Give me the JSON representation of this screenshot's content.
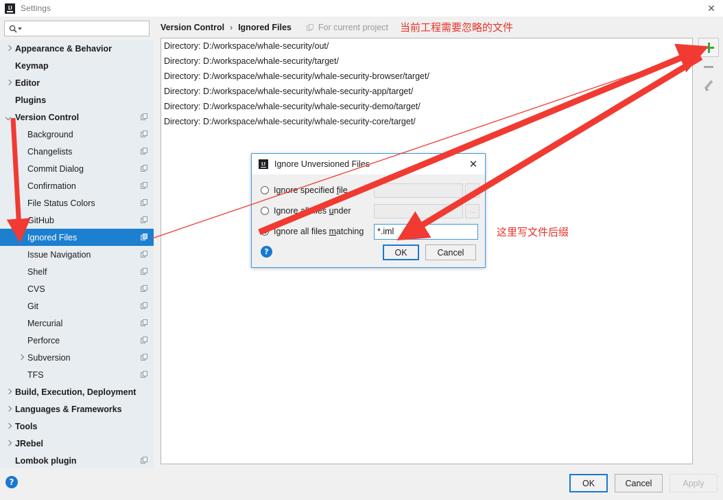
{
  "window": {
    "title": "Settings",
    "logo_text": "IJ",
    "close_label": "✕"
  },
  "search": {
    "placeholder": "",
    "value": "",
    "icon": "search-icon"
  },
  "sidebar": {
    "items": [
      {
        "label": "Appearance & Behavior",
        "level": 0,
        "bold": true,
        "twisty": "right",
        "copy": false,
        "selected": false
      },
      {
        "label": "Keymap",
        "level": 0,
        "bold": true,
        "twisty": "none",
        "copy": false,
        "selected": false
      },
      {
        "label": "Editor",
        "level": 0,
        "bold": true,
        "twisty": "right",
        "copy": false,
        "selected": false
      },
      {
        "label": "Plugins",
        "level": 0,
        "bold": true,
        "twisty": "none",
        "copy": false,
        "selected": false
      },
      {
        "label": "Version Control",
        "level": 0,
        "bold": true,
        "twisty": "down",
        "copy": true,
        "selected": false
      },
      {
        "label": "Background",
        "level": 1,
        "bold": false,
        "twisty": "none",
        "copy": true,
        "selected": false
      },
      {
        "label": "Changelists",
        "level": 1,
        "bold": false,
        "twisty": "none",
        "copy": true,
        "selected": false
      },
      {
        "label": "Commit Dialog",
        "level": 1,
        "bold": false,
        "twisty": "none",
        "copy": true,
        "selected": false
      },
      {
        "label": "Confirmation",
        "level": 1,
        "bold": false,
        "twisty": "none",
        "copy": true,
        "selected": false
      },
      {
        "label": "File Status Colors",
        "level": 1,
        "bold": false,
        "twisty": "none",
        "copy": true,
        "selected": false
      },
      {
        "label": "GitHub",
        "level": 1,
        "bold": false,
        "twisty": "none",
        "copy": true,
        "selected": false
      },
      {
        "label": "Ignored Files",
        "level": 1,
        "bold": false,
        "twisty": "none",
        "copy": true,
        "selected": true
      },
      {
        "label": "Issue Navigation",
        "level": 1,
        "bold": false,
        "twisty": "none",
        "copy": true,
        "selected": false
      },
      {
        "label": "Shelf",
        "level": 1,
        "bold": false,
        "twisty": "none",
        "copy": true,
        "selected": false
      },
      {
        "label": "CVS",
        "level": 1,
        "bold": false,
        "twisty": "none",
        "copy": true,
        "selected": false
      },
      {
        "label": "Git",
        "level": 1,
        "bold": false,
        "twisty": "none",
        "copy": true,
        "selected": false
      },
      {
        "label": "Mercurial",
        "level": 1,
        "bold": false,
        "twisty": "none",
        "copy": true,
        "selected": false
      },
      {
        "label": "Perforce",
        "level": 1,
        "bold": false,
        "twisty": "none",
        "copy": true,
        "selected": false
      },
      {
        "label": "Subversion",
        "level": 1,
        "bold": false,
        "twisty": "right",
        "copy": true,
        "selected": false
      },
      {
        "label": "TFS",
        "level": 1,
        "bold": false,
        "twisty": "none",
        "copy": true,
        "selected": false
      },
      {
        "label": "Build, Execution, Deployment",
        "level": 0,
        "bold": true,
        "twisty": "right",
        "copy": false,
        "selected": false
      },
      {
        "label": "Languages & Frameworks",
        "level": 0,
        "bold": true,
        "twisty": "right",
        "copy": false,
        "selected": false
      },
      {
        "label": "Tools",
        "level": 0,
        "bold": true,
        "twisty": "right",
        "copy": false,
        "selected": false
      },
      {
        "label": "JRebel",
        "level": 0,
        "bold": true,
        "twisty": "right",
        "copy": false,
        "selected": false
      },
      {
        "label": "Lombok plugin",
        "level": 0,
        "bold": true,
        "twisty": "none",
        "copy": true,
        "selected": false
      }
    ]
  },
  "breadcrumb": {
    "parent": "Version Control",
    "separator": "›",
    "current": "Ignored Files",
    "scope": "For current project"
  },
  "annotations": {
    "top_note": "当前工程需要忽略的文件",
    "field_note": "这里写文件后缀",
    "color": "#e8322a"
  },
  "ignored_list": {
    "rows": [
      "Directory: D:/workspace/whale-security/out/",
      "Directory: D:/workspace/whale-security/target/",
      "Directory: D:/workspace/whale-security/whale-security-browser/target/",
      "Directory: D:/workspace/whale-security/whale-security-app/target/",
      "Directory: D:/workspace/whale-security/whale-security-demo/target/",
      "Directory: D:/workspace/whale-security/whale-security-core/target/"
    ]
  },
  "side_toolbar": {
    "add": "add-icon",
    "remove": "remove-icon",
    "edit": "edit-icon",
    "add_color": "#3aa63a"
  },
  "bottom_bar": {
    "help": "?",
    "ok": "OK",
    "cancel": "Cancel",
    "apply": "Apply"
  },
  "dialog": {
    "title": "Ignore Unversioned Files",
    "logo_text": "IJ",
    "close_label": "✕",
    "options": [
      {
        "label_prefix": "Ignore specified ",
        "label_mnemonic": "f",
        "label_suffix": "ile",
        "selected": false
      },
      {
        "label_prefix": "Ignore all files ",
        "label_mnemonic": "u",
        "label_suffix": "nder",
        "selected": false
      },
      {
        "label_prefix": "Ignore all files ",
        "label_mnemonic": "m",
        "label_suffix": "atching",
        "selected": true
      }
    ],
    "browse_label": "...",
    "field_specified_file": "",
    "field_all_under": "",
    "field_matching": "*.iml",
    "help": "?",
    "ok": "OK",
    "cancel": "Cancel"
  }
}
